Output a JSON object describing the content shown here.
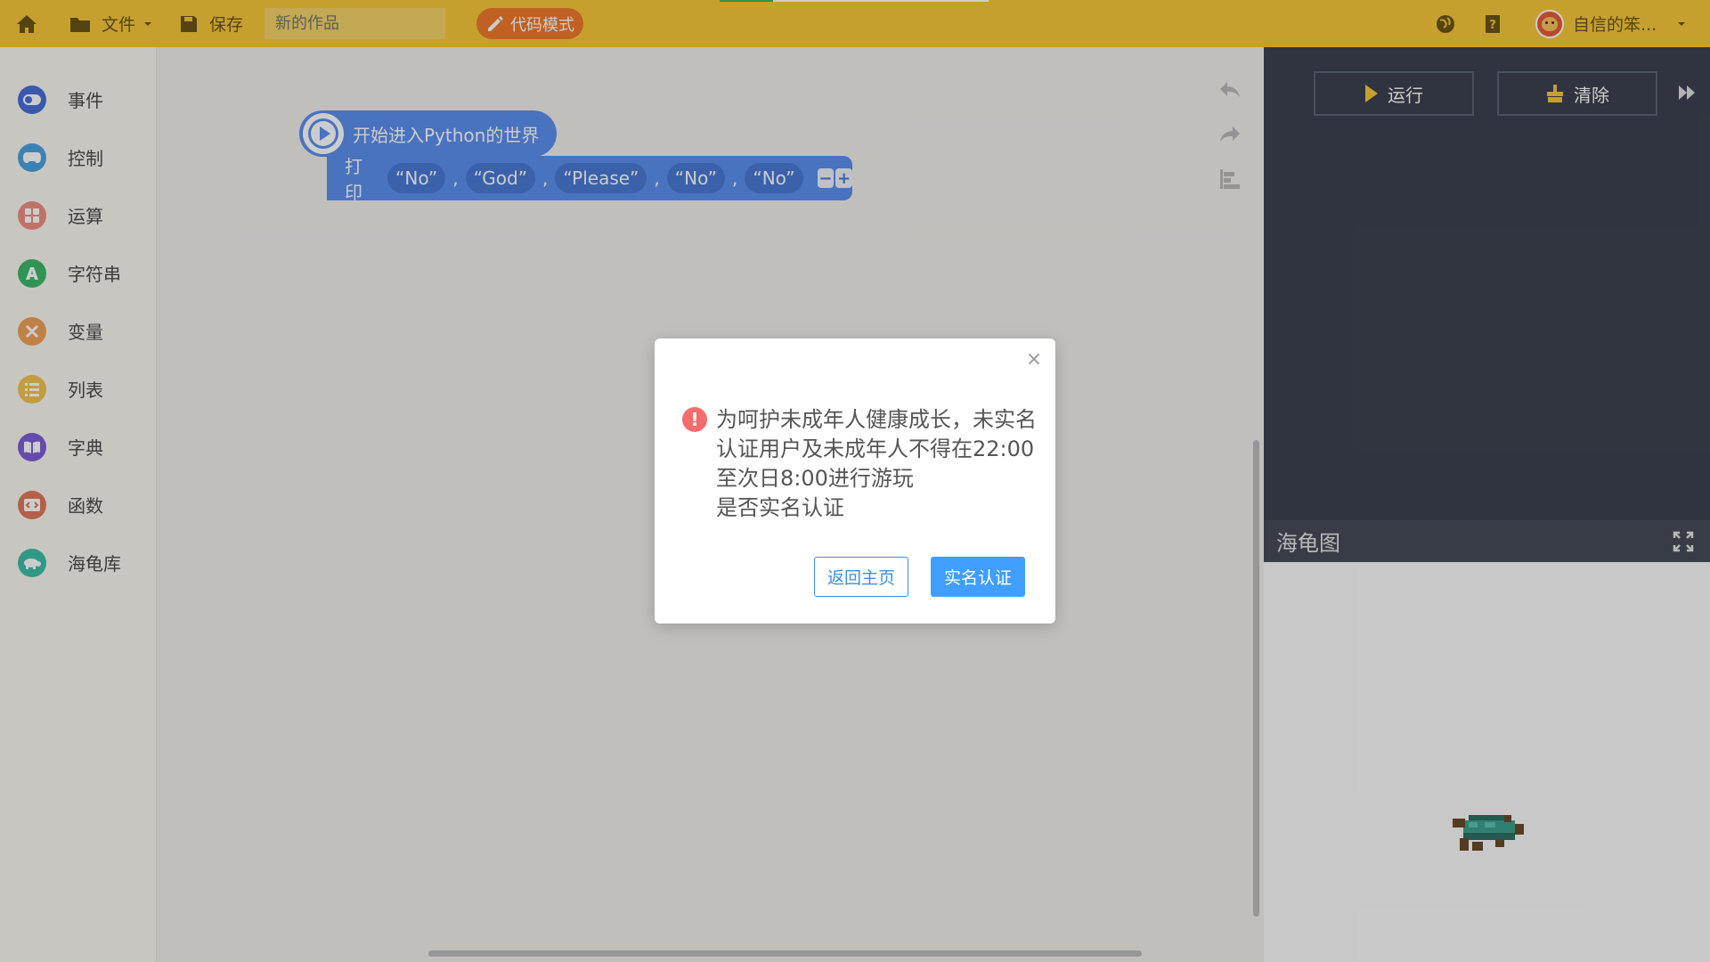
{
  "topbar": {
    "file_label": "文件",
    "save_label": "保存",
    "title_placeholder": "新的作品",
    "code_mode_label": "代码模式",
    "username": "自信的笨..."
  },
  "sidebar": {
    "items": [
      {
        "label": "事件",
        "icon": "toggle-icon",
        "color": "#4a6fd8"
      },
      {
        "label": "控制",
        "icon": "gamepad-icon",
        "color": "#4aa3e0"
      },
      {
        "label": "运算",
        "icon": "calculator-icon",
        "color": "#f08f82"
      },
      {
        "label": "字符串",
        "icon": "string-a-icon",
        "color": "#3fb86a"
      },
      {
        "label": "变量",
        "icon": "variable-x-icon",
        "color": "#f0a259"
      },
      {
        "label": "列表",
        "icon": "list-icon",
        "color": "#f3c350"
      },
      {
        "label": "字典",
        "icon": "book-icon",
        "color": "#7c5fd8"
      },
      {
        "label": "函数",
        "icon": "function-icon",
        "color": "#e2785c"
      },
      {
        "label": "海龟库",
        "icon": "turtle-icon",
        "color": "#3cc0a7"
      }
    ]
  },
  "blocks": {
    "start_label": "开始进入Python的世界",
    "print_label": "打印",
    "args": [
      "“No”",
      "“God”",
      "“Please”",
      "“No”",
      "“No”"
    ],
    "comma": ",",
    "minus": "−",
    "plus": "+"
  },
  "panel": {
    "run_label": "运行",
    "clear_label": "清除",
    "turtle_title": "海龟图"
  },
  "dialog": {
    "close": "×",
    "warn_glyph": "!",
    "message_line1": "为呵护未成年人健康成长，未实名认证用户及未成年人不得在22:00至次日8:00进行游玩",
    "message_line2": "是否实名认证",
    "back_label": "返回主页",
    "verify_label": "实名认证"
  }
}
